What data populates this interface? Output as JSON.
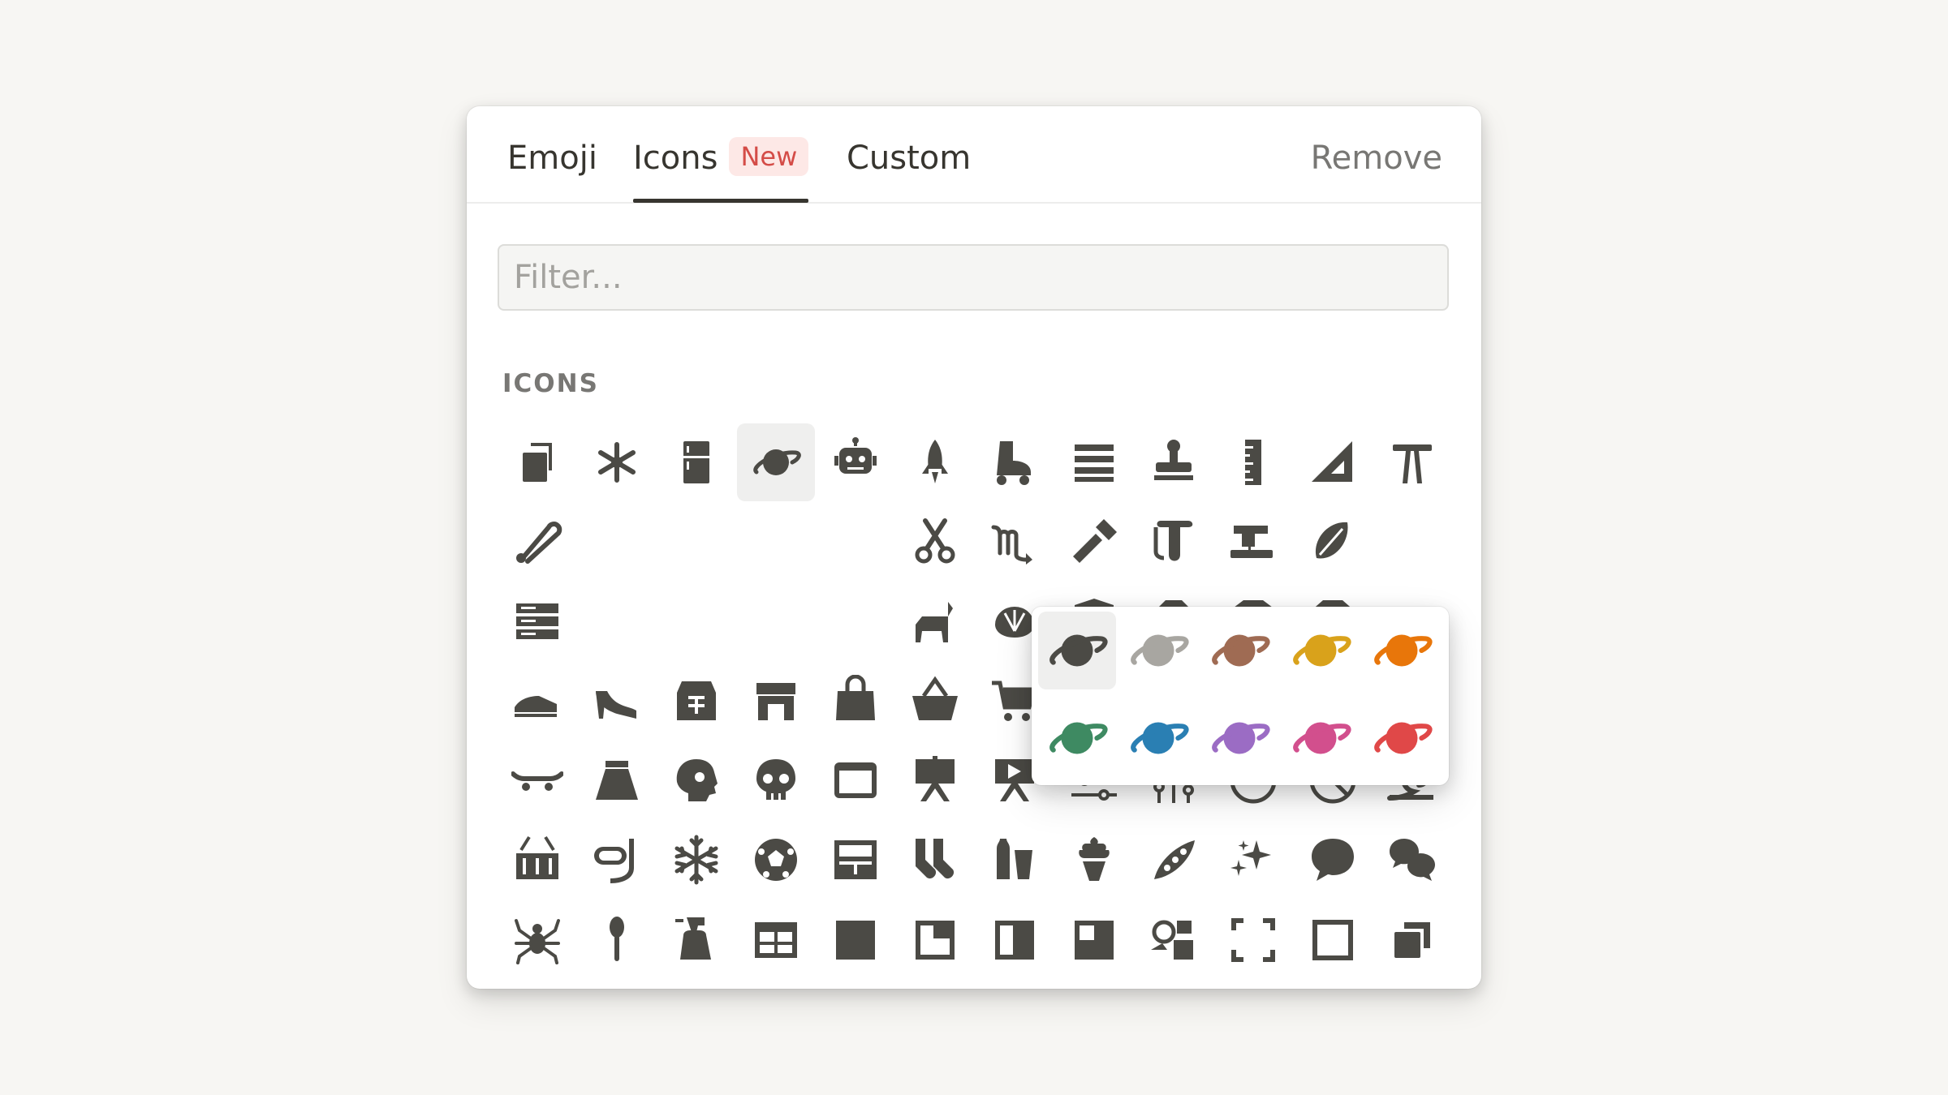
{
  "tabs": [
    {
      "label": "Emoji"
    },
    {
      "label": "Icons",
      "badge": "New"
    },
    {
      "label": "Custom"
    }
  ],
  "remove_label": "Remove",
  "filter": {
    "placeholder": "Filter...",
    "value": ""
  },
  "section_title": "ICONS",
  "icon_color": "#4b4a45",
  "selected_icon": "planet-icon",
  "icon_rows": [
    [
      "copy-icon",
      "asterisk-icon",
      "fridge-icon",
      "planet-icon",
      "robot-icon",
      "rocket-icon",
      "roller-skate-icon",
      "rows-icon",
      "rubber-stamp-icon",
      "ruler-icon",
      "set-square-icon",
      "sawhorse-icon"
    ],
    [
      "safety-pin-icon",
      "",
      "",
      "",
      "",
      "scissors-icon",
      "scorpio-icon",
      "screwdriver-icon",
      "scroll-icon",
      "sewing-machine-icon",
      "seed-icon"
    ],
    [
      "server-icon",
      "",
      "",
      "",
      "",
      "goat-icon",
      "shell-icon",
      "shield-icon",
      "jacket-icon",
      "sweater-icon",
      "t-shirt-icon"
    ],
    [
      "sneaker-icon",
      "high-heel-icon",
      "shop-icon",
      "storefront-icon",
      "shopping-bag-icon",
      "shopping-basket-icon",
      "shopping-cart-icon",
      "shorts-icon",
      "shovel-pail-icon",
      "shower-icon",
      "shrine-icon",
      "sink-icon"
    ],
    [
      "skateboard-icon",
      "skirt-icon",
      "skull-side-icon",
      "skull-icon",
      "window-icon",
      "easel-icon",
      "easel-play-icon",
      "sliders-horizontal-icon",
      "sliders-vertical-icon",
      "smoking-icon",
      "no-smoking-icon",
      "snail-icon"
    ],
    [
      "snare-drum-icon",
      "snorkel-icon",
      "snowflake-icon",
      "soccer-ball-icon",
      "solar-panel-icon",
      "socks-icon",
      "soda-icon",
      "soft-serve-icon",
      "peas-icon",
      "sparkles-icon",
      "speech-bubble-icon",
      "speech-bubbles-icon"
    ],
    [
      "spider-icon",
      "spoon-icon",
      "spray-bottle-icon",
      "table-icon",
      "square-icon",
      "square-corner-icon",
      "square-half-icon",
      "square-inset-icon",
      "shapes-icon",
      "selection-icon",
      "square-outline-icon",
      "copy-stack-icon"
    ]
  ],
  "color_variants": [
    {
      "name": "dark-gray",
      "color": "#4b4a45",
      "ring": "#4b4a45"
    },
    {
      "name": "gray",
      "color": "#a8a6a1",
      "ring": "#a8a6a1"
    },
    {
      "name": "brown",
      "color": "#9f6b53",
      "ring": "#9f6b53"
    },
    {
      "name": "yellow",
      "color": "#d9a21b",
      "ring": "#d9a21b"
    },
    {
      "name": "orange",
      "color": "#e8760a",
      "ring": "#e8760a"
    },
    {
      "name": "green",
      "color": "#3e8a62",
      "ring": "#3e8a62"
    },
    {
      "name": "blue",
      "color": "#2a7fb3",
      "ring": "#2a7fb3"
    },
    {
      "name": "purple",
      "color": "#9b6cc4",
      "ring": "#9b6cc4"
    },
    {
      "name": "pink",
      "color": "#d24f8d",
      "ring": "#d24f8d"
    },
    {
      "name": "red",
      "color": "#e04848",
      "ring": "#e04848"
    }
  ]
}
